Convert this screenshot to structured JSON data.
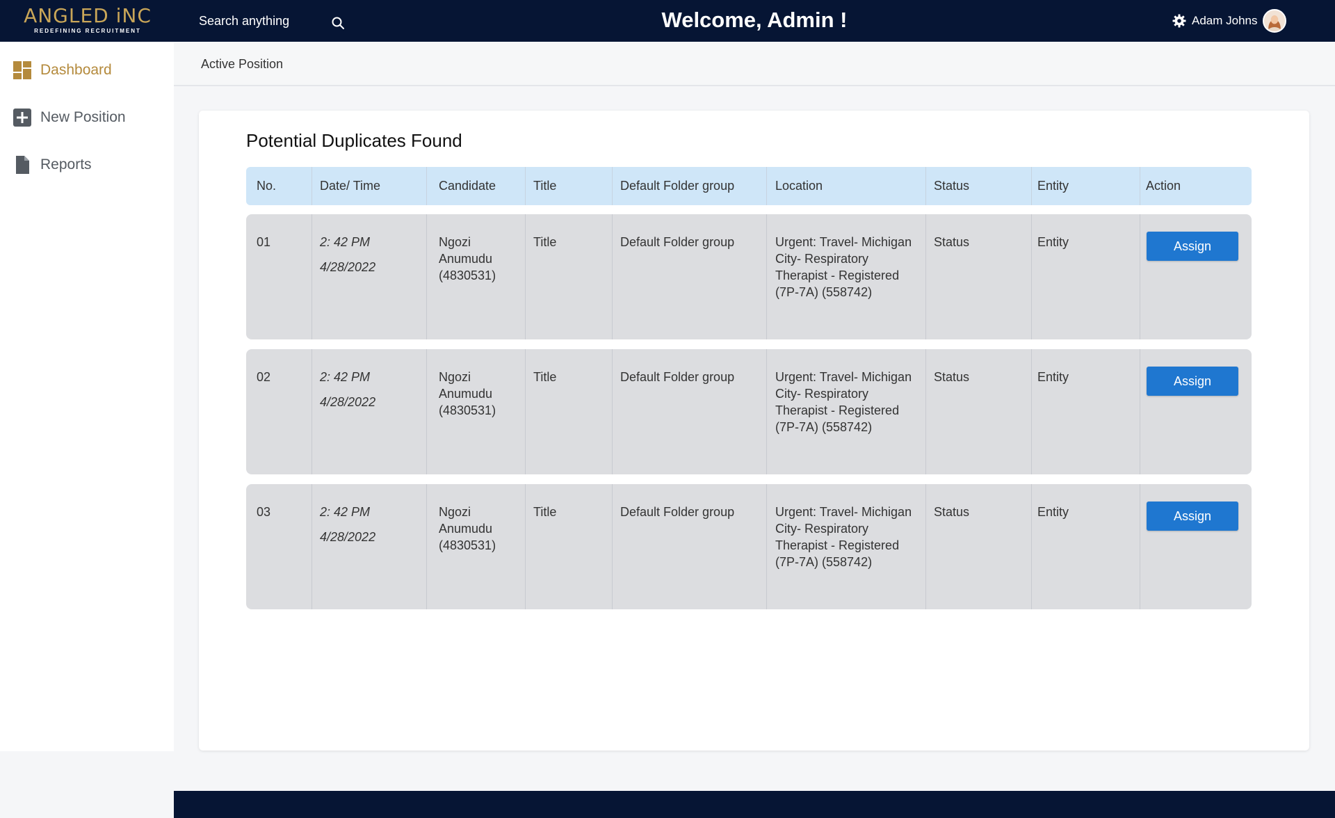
{
  "header": {
    "logo_main": "ANGLED iNC",
    "logo_sub": "REDEFINING RECRUITMENT",
    "search_placeholder": "Search anything",
    "welcome": "Welcome, Admin !",
    "user_name": "Adam Johns",
    "icons": {
      "search": "search-icon",
      "settings": "gear-icon"
    }
  },
  "sidebar": {
    "items": [
      {
        "label": "Dashboard",
        "icon": "dashboard-icon",
        "active": true
      },
      {
        "label": "New Position",
        "icon": "plus-square-icon",
        "active": false
      },
      {
        "label": "Reports",
        "icon": "document-icon",
        "active": false
      }
    ]
  },
  "subheader": {
    "title": "Active Position"
  },
  "card": {
    "title": "Potential Duplicates Found",
    "columns": [
      "No.",
      "Date/ Time",
      "Candidate",
      "Title",
      "Default Folder group",
      "Location",
      "Status",
      "Entity",
      "Action"
    ],
    "rows": [
      {
        "no": "01",
        "time": "2: 42 PM",
        "date": "4/28/2022",
        "candidate_1": "Ngozi",
        "candidate_2": "Anumudu",
        "candidate_3": "(4830531)",
        "title": "Title",
        "folder": "Default Folder group",
        "loc_1": "Urgent: Travel- Michigan",
        "loc_2": "City- Respiratory",
        "loc_3": "Therapist - Registered",
        "loc_4": "(7P-7A) (558742)",
        "status": "Status",
        "entity": "Entity",
        "action": "Assign"
      },
      {
        "no": "02",
        "time": "2: 42 PM",
        "date": "4/28/2022",
        "candidate_1": "Ngozi",
        "candidate_2": "Anumudu",
        "candidate_3": "(4830531)",
        "title": "Title",
        "folder": "Default Folder group",
        "loc_1": "Urgent: Travel- Michigan",
        "loc_2": "City- Respiratory",
        "loc_3": "Therapist - Registered",
        "loc_4": "(7P-7A) (558742)",
        "status": "Status",
        "entity": "Entity",
        "action": "Assign"
      },
      {
        "no": "03",
        "time": "2: 42 PM",
        "date": "4/28/2022",
        "candidate_1": "Ngozi",
        "candidate_2": "Anumudu",
        "candidate_3": "(4830531)",
        "title": "Title",
        "folder": "Default Folder group",
        "loc_1": "Urgent: Travel- Michigan",
        "loc_2": "City- Respiratory",
        "loc_3": "Therapist - Registered",
        "loc_4": "(7P-7A) (558742)",
        "status": "Status",
        "entity": "Entity",
        "action": "Assign"
      }
    ]
  },
  "colors": {
    "topbar": "#061534",
    "accent_gold": "#b48a3c",
    "button_blue": "#1f77d0",
    "table_header": "#cfe6f8",
    "row_bg": "#dcdde0"
  }
}
